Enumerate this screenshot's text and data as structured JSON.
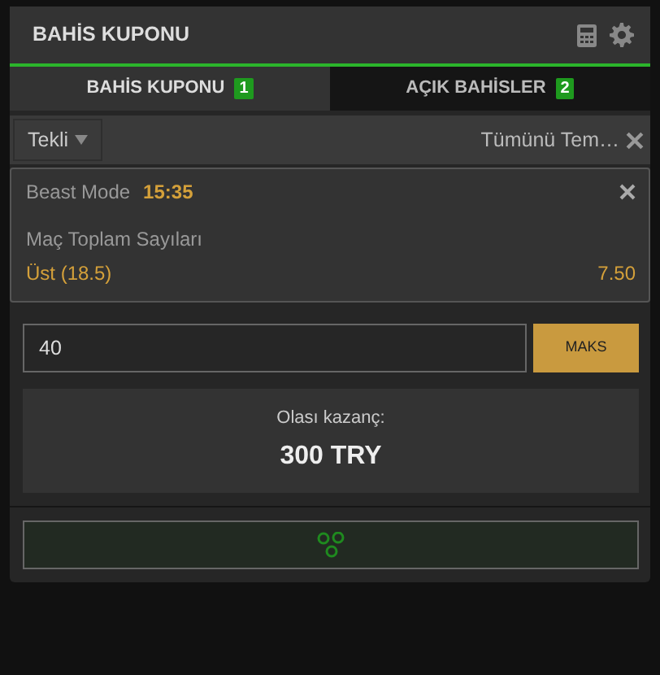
{
  "header": {
    "title": "BAHİS KUPONU"
  },
  "tabs": [
    {
      "label": "BAHİS KUPONU",
      "count": "1",
      "selected": true
    },
    {
      "label": "AÇIK BAHİSLER",
      "count": "2",
      "selected": false
    }
  ],
  "toolbar": {
    "type_select": "Tekli",
    "clear_all": "Tümünü Tem…"
  },
  "bets": [
    {
      "event": "Beast Mode",
      "time": "15:35",
      "market": "Maç Toplam Sayıları",
      "selection": "Üst (18.5)",
      "odds": "7.50"
    }
  ],
  "stake": {
    "value": "40",
    "max_button": "MAKS"
  },
  "potential_win": {
    "label": "Olası kazanç:",
    "amount": "300 TRY"
  }
}
